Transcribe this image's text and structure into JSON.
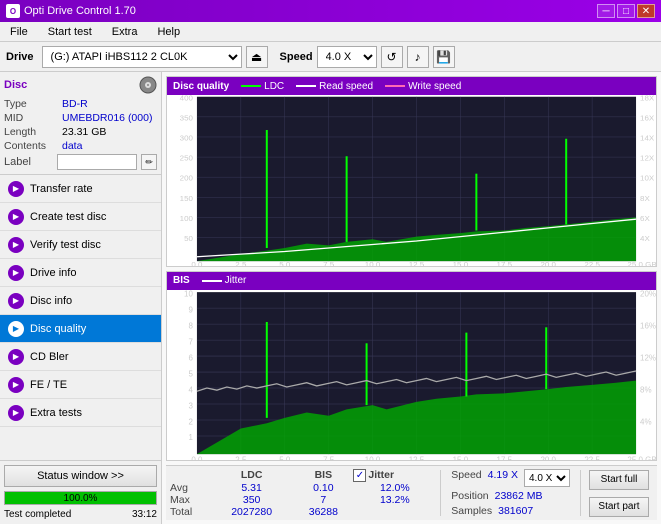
{
  "titleBar": {
    "title": "Opti Drive Control 1.70",
    "icon": "O",
    "minBtn": "─",
    "maxBtn": "□",
    "closeBtn": "✕"
  },
  "menuBar": {
    "items": [
      "File",
      "Start test",
      "Extra",
      "Help"
    ]
  },
  "toolbar": {
    "driveLabel": "Drive",
    "driveValue": "(G:) ATAPI iHBS112  2 CL0K",
    "ejectIcon": "⏏",
    "speedLabel": "Speed",
    "speedValue": "4.0 X",
    "icon1": "↺",
    "icon2": "🎵",
    "icon3": "💾"
  },
  "disc": {
    "title": "Disc",
    "typeLabel": "Type",
    "typeValue": "BD-R",
    "midLabel": "MID",
    "midValue": "UMEBDR016 (000)",
    "lengthLabel": "Length",
    "lengthValue": "23.31 GB",
    "contentsLabel": "Contents",
    "contentsValue": "data",
    "labelLabel": "Label",
    "labelValue": ""
  },
  "navItems": [
    {
      "id": "transfer-rate",
      "label": "Transfer rate",
      "active": false
    },
    {
      "id": "create-test-disc",
      "label": "Create test disc",
      "active": false
    },
    {
      "id": "verify-test-disc",
      "label": "Verify test disc",
      "active": false
    },
    {
      "id": "drive-info",
      "label": "Drive info",
      "active": false
    },
    {
      "id": "disc-info",
      "label": "Disc info",
      "active": false
    },
    {
      "id": "disc-quality",
      "label": "Disc quality",
      "active": true
    },
    {
      "id": "cd-bler",
      "label": "CD Bler",
      "active": false
    },
    {
      "id": "fe-te",
      "label": "FE / TE",
      "active": false
    },
    {
      "id": "extra-tests",
      "label": "Extra tests",
      "active": false
    }
  ],
  "statusBtn": "Status window >>",
  "progressValue": 100,
  "progressText": "100.0%",
  "statusText": "Test completed",
  "timeText": "33:12",
  "chart1": {
    "title": "Disc quality",
    "legend": {
      "ldc": "LDC",
      "read": "Read speed",
      "write": "Write speed"
    },
    "yAxisMax": 400,
    "yAxisLabels": [
      "400",
      "350",
      "300",
      "250",
      "200",
      "150",
      "100",
      "50",
      "0"
    ],
    "y2AxisLabels": [
      "18X",
      "16X",
      "14X",
      "12X",
      "10X",
      "8X",
      "6X",
      "4X",
      "2X"
    ],
    "xAxisLabels": [
      "0.0",
      "2.5",
      "5.0",
      "7.5",
      "10.0",
      "12.5",
      "15.0",
      "17.5",
      "20.0",
      "22.5",
      "25.0 GB"
    ]
  },
  "chart2": {
    "title": "BIS",
    "legend": {
      "jitter": "Jitter"
    },
    "yAxisMax": 10,
    "yAxisLabels": [
      "10",
      "9",
      "8",
      "7",
      "6",
      "5",
      "4",
      "3",
      "2",
      "1"
    ],
    "y2AxisLabels": [
      "20%",
      "16%",
      "12%",
      "8%",
      "4%"
    ],
    "xAxisLabels": [
      "0.0",
      "2.5",
      "5.0",
      "7.5",
      "10.0",
      "12.5",
      "15.0",
      "17.5",
      "20.0",
      "22.5",
      "25.0 GB"
    ]
  },
  "stats": {
    "avgLdc": "5.31",
    "avgBis": "0.10",
    "avgJitter": "12.0%",
    "maxLdc": "350",
    "maxBis": "7",
    "maxJitter": "13.2%",
    "totalLdc": "2027280",
    "totalBis": "36288",
    "speedLabel": "Speed",
    "speedValue": "4.19 X",
    "speedTarget": "4.0 X",
    "positionLabel": "Position",
    "positionValue": "23862 MB",
    "samplesLabel": "Samples",
    "samplesValue": "381607",
    "colHeaders": {
      "ldc": "LDC",
      "bis": "BIS",
      "jitter": "Jitter"
    },
    "rowLabels": {
      "avg": "Avg",
      "max": "Max",
      "total": "Total"
    },
    "startFull": "Start full",
    "startPart": "Start part"
  }
}
